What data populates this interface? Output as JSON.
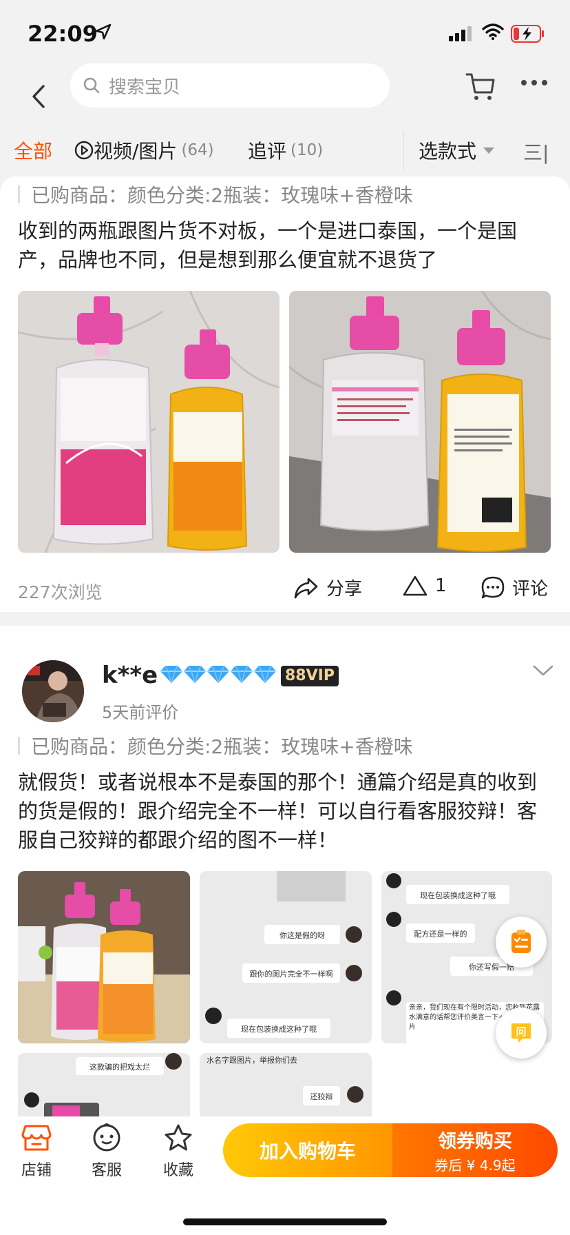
{
  "status": {
    "time": "22:09"
  },
  "search": {
    "placeholder": "搜索宝贝"
  },
  "tabs": {
    "all": "全部",
    "video": {
      "label": "视频/图片",
      "count": "(64)"
    },
    "followup": {
      "label": "追评",
      "count": "(10)"
    },
    "style": "选款式",
    "sort": "三|"
  },
  "reviews": [
    {
      "purchased": "已购商品：颜色分类:2瓶装：玫瑰味+香橙味",
      "text": "收到的两瓶跟图片货不对板，一个是进口泰国，一个是国产，品牌也不同，但是想到那么便宜就不退货了",
      "views": "227次浏览",
      "share": "分享",
      "likes": "1",
      "comment": "评论"
    },
    {
      "user": "k**e",
      "vip": "88VIP",
      "date": "5天前评价",
      "purchased": "已购商品：颜色分类:2瓶装：玫瑰味+香橙味",
      "text": "就假货！或者说根本不是泰国的那个！通篇介绍是真的收到的货是假的！跟介绍完全不一样！可以自行看客服狡辩！客服自己狡辩的都跟介绍的图不一样！",
      "chat_msgs": {
        "p2a": "你这是假的呀",
        "p2b": "跟你的图片完全不一样啊",
        "p2c": "现在包装换成这种了哦",
        "p3a": "现在包装换成这种了哦",
        "p3b": "配方还是一样的",
        "p3c": "你还写假一赔",
        "p3d": "亲亲，我们现在有个限时活动，您收到花露水满意的话帮您评价美言一下+晒美美的图片",
        "p4a": "这款骗的把戏太烂",
        "p5a": "水名字跟图片，举报你们去",
        "p5b": "还狡辩"
      }
    }
  ],
  "bottom": {
    "shop": "店铺",
    "service": "客服",
    "favorite": "收藏",
    "add_cart": "加入购物车",
    "buy": "领券购买",
    "buy_sub": "券后 ¥ 4.9起"
  },
  "colors": {
    "accent": "#ff5000",
    "cart_btn": "#ffb000",
    "buy_btn": "#ff5a00"
  }
}
